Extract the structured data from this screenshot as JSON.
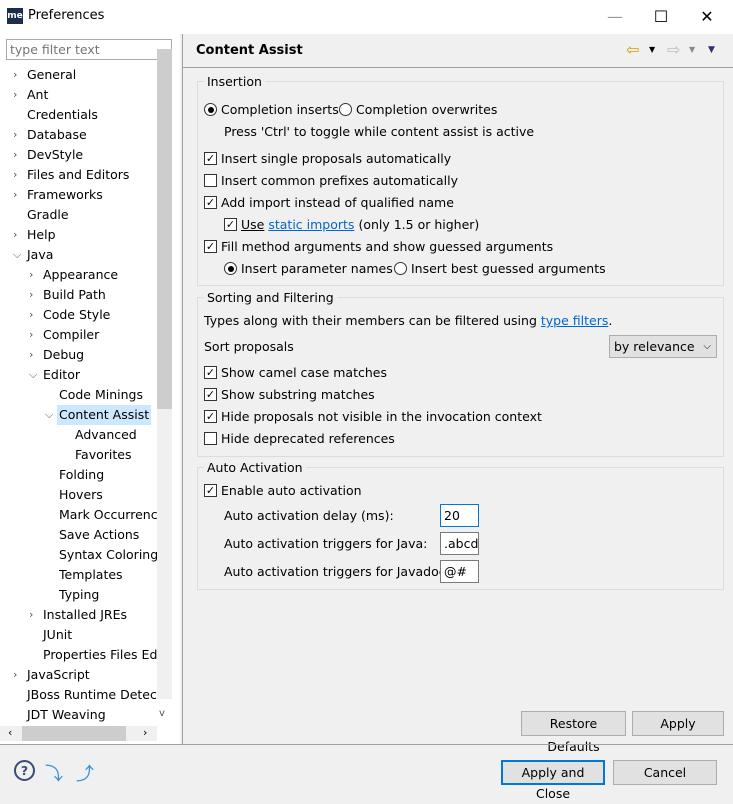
{
  "window": {
    "logo": "me",
    "title": "Preferences",
    "minimize": "—",
    "maximize": "☐",
    "close": "✕"
  },
  "sidebar": {
    "filter_placeholder": "type filter text",
    "items": [
      {
        "label": "General",
        "level": 0,
        "exp": ">"
      },
      {
        "label": "Ant",
        "level": 0,
        "exp": ">"
      },
      {
        "label": "Credentials",
        "level": 0,
        "exp": ""
      },
      {
        "label": "Database",
        "level": 0,
        "exp": ">"
      },
      {
        "label": "DevStyle",
        "level": 0,
        "exp": ">"
      },
      {
        "label": "Files and Editors",
        "level": 0,
        "exp": ">"
      },
      {
        "label": "Frameworks",
        "level": 0,
        "exp": ">"
      },
      {
        "label": "Gradle",
        "level": 0,
        "exp": ""
      },
      {
        "label": "Help",
        "level": 0,
        "exp": ">"
      },
      {
        "label": "Java",
        "level": 0,
        "exp": "v"
      },
      {
        "label": "Appearance",
        "level": 1,
        "exp": ">"
      },
      {
        "label": "Build Path",
        "level": 1,
        "exp": ">"
      },
      {
        "label": "Code Style",
        "level": 1,
        "exp": ">"
      },
      {
        "label": "Compiler",
        "level": 1,
        "exp": ">"
      },
      {
        "label": "Debug",
        "level": 1,
        "exp": ">"
      },
      {
        "label": "Editor",
        "level": 1,
        "exp": "v"
      },
      {
        "label": "Code Minings",
        "level": 2,
        "exp": ""
      },
      {
        "label": "Content Assist",
        "level": 2,
        "exp": "v",
        "selected": true
      },
      {
        "label": "Advanced",
        "level": 3,
        "exp": ""
      },
      {
        "label": "Favorites",
        "level": 3,
        "exp": ""
      },
      {
        "label": "Folding",
        "level": 2,
        "exp": ""
      },
      {
        "label": "Hovers",
        "level": 2,
        "exp": ""
      },
      {
        "label": "Mark Occurrences",
        "level": 2,
        "exp": ""
      },
      {
        "label": "Save Actions",
        "level": 2,
        "exp": ""
      },
      {
        "label": "Syntax Coloring",
        "level": 2,
        "exp": ""
      },
      {
        "label": "Templates",
        "level": 2,
        "exp": ""
      },
      {
        "label": "Typing",
        "level": 2,
        "exp": ""
      },
      {
        "label": "Installed JREs",
        "level": 1,
        "exp": ">"
      },
      {
        "label": "JUnit",
        "level": 1,
        "exp": ""
      },
      {
        "label": "Properties Files Editor",
        "level": 1,
        "exp": ""
      },
      {
        "label": "JavaScript",
        "level": 0,
        "exp": ">"
      },
      {
        "label": "JBoss Runtime Detection",
        "level": 0,
        "exp": ""
      },
      {
        "label": "JDT Weaving",
        "level": 0,
        "exp": ""
      }
    ]
  },
  "header": {
    "title": "Content Assist",
    "back": "⇦",
    "forward": "⇨",
    "menu": "▼"
  },
  "insertion": {
    "legend": "Insertion",
    "completion_inserts": "Completion inserts",
    "completion_overwrites": "Completion overwrites",
    "hint": "Press 'Ctrl' to toggle while content assist is active",
    "single": "Insert single proposals automatically",
    "prefixes": "Insert common prefixes automatically",
    "add_import": "Add import instead of qualified name",
    "use": "Use",
    "static_imports": "static imports",
    "only15": "(only 1.5 or higher)",
    "fill": "Fill method arguments and show guessed arguments",
    "param_names": "Insert parameter names",
    "best_guessed": "Insert best guessed arguments"
  },
  "sorting": {
    "legend": "Sorting and Filtering",
    "desc": "Types along with their members can be filtered using",
    "type_filters": "type filters",
    "period": ".",
    "sort_label": "Sort proposals",
    "sort_value": "by relevance",
    "camel": "Show camel case matches",
    "substring": "Show substring matches",
    "hide_invisible": "Hide proposals not visible in the invocation context",
    "hide_deprecated": "Hide deprecated references"
  },
  "auto": {
    "legend": "Auto Activation",
    "enable": "Enable auto activation",
    "delay_label": "Auto activation delay (ms):",
    "delay": "20",
    "java_label": "Auto activation triggers for Java:",
    "java": ".abcd",
    "javadoc_label": "Auto activation triggers for Javadoc:",
    "javadoc": "@#"
  },
  "buttons": {
    "restore": "Restore Defaults",
    "apply": "Apply",
    "apply_close": "Apply and Close",
    "cancel": "Cancel"
  }
}
